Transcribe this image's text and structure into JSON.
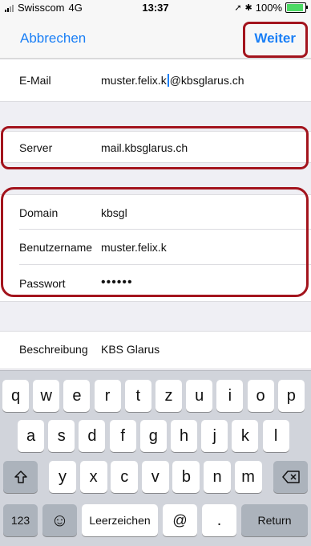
{
  "status_bar": {
    "carrier": "Swisscom",
    "network": "4G",
    "time": "13:37",
    "battery": "100%",
    "battery_level": 1.0
  },
  "navbar": {
    "cancel_label": "Abbrechen",
    "next_label": "Weiter"
  },
  "fields": {
    "email_label": "E-Mail",
    "email_before_caret": "muster.felix.k",
    "email_after_caret": "@kbsglarus.ch",
    "server_label": "Server",
    "server_value": "mail.kbsglarus.ch",
    "domain_label": "Domain",
    "domain_value": "kbsgl",
    "username_label": "Benutzername",
    "username_value": "muster.felix.k",
    "password_label": "Passwort",
    "password_value": "••••••",
    "description_label": "Beschreibung",
    "description_value": "KBS Glarus"
  },
  "keyboard": {
    "row1": [
      "q",
      "w",
      "e",
      "r",
      "t",
      "z",
      "u",
      "i",
      "o",
      "p"
    ],
    "row2": [
      "a",
      "s",
      "d",
      "f",
      "g",
      "h",
      "j",
      "k",
      "l"
    ],
    "row3": [
      "y",
      "x",
      "c",
      "v",
      "b",
      "n",
      "m"
    ],
    "numbers_key": "123",
    "emoji_key": "☺",
    "space_key": "Leerzeichen",
    "at_key": "@",
    "dot_key": ".",
    "return_key": "Return",
    "shift_icon": "shift-icon",
    "backspace_icon": "backspace-icon"
  }
}
